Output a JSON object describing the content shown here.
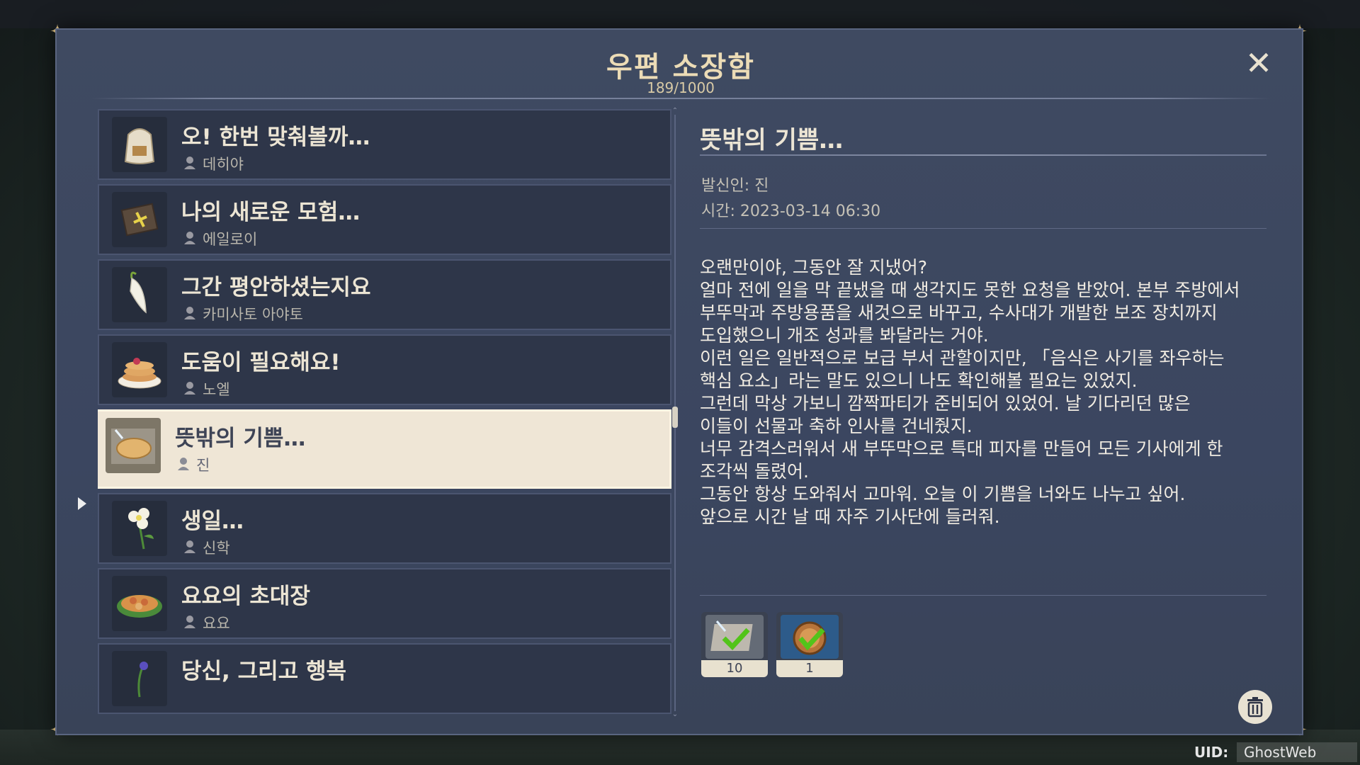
{
  "mailbox": {
    "title": "우편 소장함",
    "count": "189/1000",
    "close_icon": "close-icon"
  },
  "mail_list": [
    {
      "subject": "오! 한번 맞춰볼까…",
      "sender": "데히야",
      "icon": "flour-sack-icon"
    },
    {
      "subject": "나의 새로운 모험…",
      "sender": "에일로이",
      "icon": "sealed-package-icon"
    },
    {
      "subject": "그간 평안하셨는지요",
      "sender": "카미사토 아야토",
      "icon": "radish-icon"
    },
    {
      "subject": "도움이 필요해요!",
      "sender": "노엘",
      "icon": "pancake-icon"
    },
    {
      "subject": "뜻밖의 기쁨…",
      "sender": "진",
      "icon": "pizza-icon"
    },
    {
      "subject": "생일…",
      "sender": "신학",
      "icon": "flower-icon"
    },
    {
      "subject": "요요의 초대장",
      "sender": "요요",
      "icon": "dish-icon"
    },
    {
      "subject": "당신, 그리고 행복",
      "sender": "",
      "icon": "plant-icon"
    }
  ],
  "selected_index": 4,
  "detail": {
    "title": "뜻밖의 기쁨…",
    "sender": "발신인: 진",
    "time": "시간: 2023-03-14 06:30",
    "body": "오랜만이야, 그동안 잘 지냈어?\n얼마 전에 일을 막 끝냈을 때 생각지도 못한 요청을 받았어. 본부 주방에서\n부뚜막과 주방용품을 새것으로 바꾸고, 수사대가 개발한 보조 장치까지\n도입했으니 개조 성과를 봐달라는 거야.\n이런 일은 일반적으로 보급 부서 관할이지만, 「음식은 사기를 좌우하는\n핵심 요소」라는 말도 있으니 나도 확인해볼 필요는 있었지.\n그런데 막상 가보니 깜짝파티가 준비되어 있었어. 날 기다리던 많은\n이들이 선물과 축하 인사를 건네줬지.\n너무 감격스러워서 새 부뚜막으로 특대 피자를 만들어 모든 기사에게 한\n조각씩 돌렸어.\n그동안 항상 도와줘서 고마워. 오늘 이 기쁨을 너와도 나누고 싶어.\n앞으로 시간 날 때 자주 기사단에 들러줘.",
    "attachments": [
      {
        "icon": "pizza-recipe-icon",
        "count": "10",
        "claimed": true
      },
      {
        "icon": "compass-icon",
        "count": "1",
        "claimed": true
      }
    ]
  },
  "uid": {
    "label": "UID:",
    "value": "GhostWeb"
  },
  "colors": {
    "accent": "#ecdcb6",
    "panel": "#3f4a61",
    "selected": "#efe6d6",
    "claimed": "#52c41a"
  }
}
